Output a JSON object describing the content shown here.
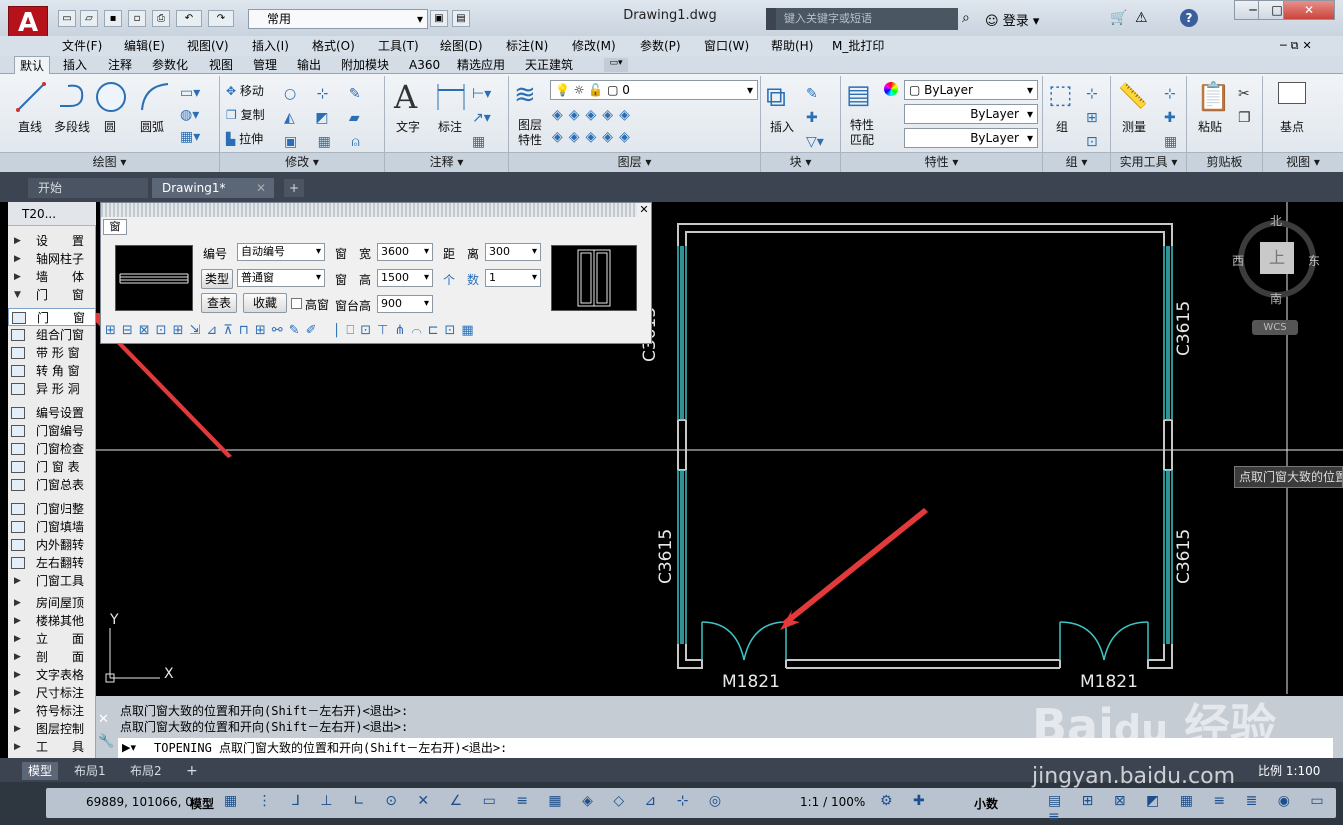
{
  "app": {
    "logo_letter": "A",
    "doc_title": "Drawing1.dwg",
    "workspace": "常用",
    "search_placeholder": "键入关键字或短语",
    "login": "登录",
    "window_buttons": [
      "─",
      "□",
      "✕"
    ],
    "mdi_buttons": [
      "─",
      "⧉",
      "✕"
    ]
  },
  "menu": [
    "文件(F)",
    "编辑(E)",
    "视图(V)",
    "插入(I)",
    "格式(O)",
    "工具(T)",
    "绘图(D)",
    "标注(N)",
    "修改(M)",
    "参数(P)",
    "窗口(W)",
    "帮助(H)",
    "M_批打印"
  ],
  "ribbon_tabs": [
    "默认",
    "插入",
    "注释",
    "参数化",
    "视图",
    "管理",
    "输出",
    "附加模块",
    "A360",
    "精选应用",
    "天正建筑"
  ],
  "ribbon": {
    "draw": [
      "直线",
      "多段线",
      "圆",
      "圆弧"
    ],
    "modify": [
      "移动",
      "复制",
      "拉伸"
    ],
    "annotate": [
      "文字",
      "标注"
    ],
    "layer_props": "图层\n特性",
    "layer_name": "0",
    "insert": "插入",
    "match_props": "特性\n匹配",
    "bylayer": [
      "ByLayer",
      "ByLayer",
      "ByLayer"
    ],
    "group": "组",
    "measure": "测量",
    "paste": "粘贴",
    "base": "基点",
    "panels": [
      "绘图 ▾",
      "修改 ▾",
      "注释 ▾",
      "图层 ▾",
      "块 ▾",
      "特性 ▾",
      "组 ▾",
      "实用工具 ▾",
      "剪贴板",
      "视图 ▾"
    ]
  },
  "doc_tabs": [
    "开始",
    "Drawing1*"
  ],
  "tool_palette": {
    "header": "T20...",
    "items": [
      "设　　置",
      "轴网柱子",
      "墙　　体",
      "门　　窗",
      "门　　窗",
      "组合门窗",
      "带 形 窗",
      "转 角 窗",
      "异 形 洞",
      "编号设置",
      "门窗编号",
      "门窗检查",
      "门 窗 表",
      "门窗总表",
      "门窗归整",
      "门窗填墙",
      "内外翻转",
      "左右翻转",
      "门窗工具",
      "房间屋顶",
      "楼梯其他",
      "立　　面",
      "剖　　面",
      "文字表格",
      "尺寸标注",
      "符号标注",
      "图层控制",
      "工　　具"
    ]
  },
  "dialog": {
    "title": "窗",
    "labels": {
      "number": "编号",
      "type": "类型",
      "width": "窗　宽",
      "height": "窗　高",
      "sill": "窗台高",
      "distance": "距　离",
      "count": "个　数",
      "high_window": "高窗"
    },
    "values": {
      "number": "自动编号",
      "type": "普通窗",
      "width": "3600",
      "height": "1500",
      "sill": "900",
      "distance": "300",
      "count": "1"
    },
    "buttons": {
      "lookup": "查表",
      "save": "收藏"
    }
  },
  "drawing": {
    "window_labels": [
      "C3615",
      "C3615",
      "C3615",
      "C3615"
    ],
    "door_labels": [
      "M1821",
      "M1821"
    ],
    "compass": {
      "north": "北",
      "south": "南",
      "east": "东",
      "west": "西",
      "center": "上",
      "wcs": "WCS"
    },
    "tooltip": "点取门窗大致的位置",
    "axis_y": "Y",
    "axis_x": "X"
  },
  "command": {
    "history": [
      "点取门窗大致的位置和开向(Shift－左右开)<退出>:",
      "点取门窗大致的位置和开向(Shift－左右开)<退出>:"
    ],
    "prompt": "TOPENING 点取门窗大致的位置和开向(Shift－左右开)<退出>:"
  },
  "layout_tabs": [
    "模型",
    "布局1",
    "布局2"
  ],
  "status": {
    "coords": "69889, 101066, 0",
    "model": "模型",
    "scale": "1:1 / 100%",
    "units": "小数",
    "layout_scale": "比例 1:100"
  },
  "watermark": "jingyan.baidu.com",
  "colors": {
    "accent": "#b5121b",
    "wall": "#c8c8c8",
    "window": "#3fc4c4",
    "arrow": "#e23a3a"
  }
}
